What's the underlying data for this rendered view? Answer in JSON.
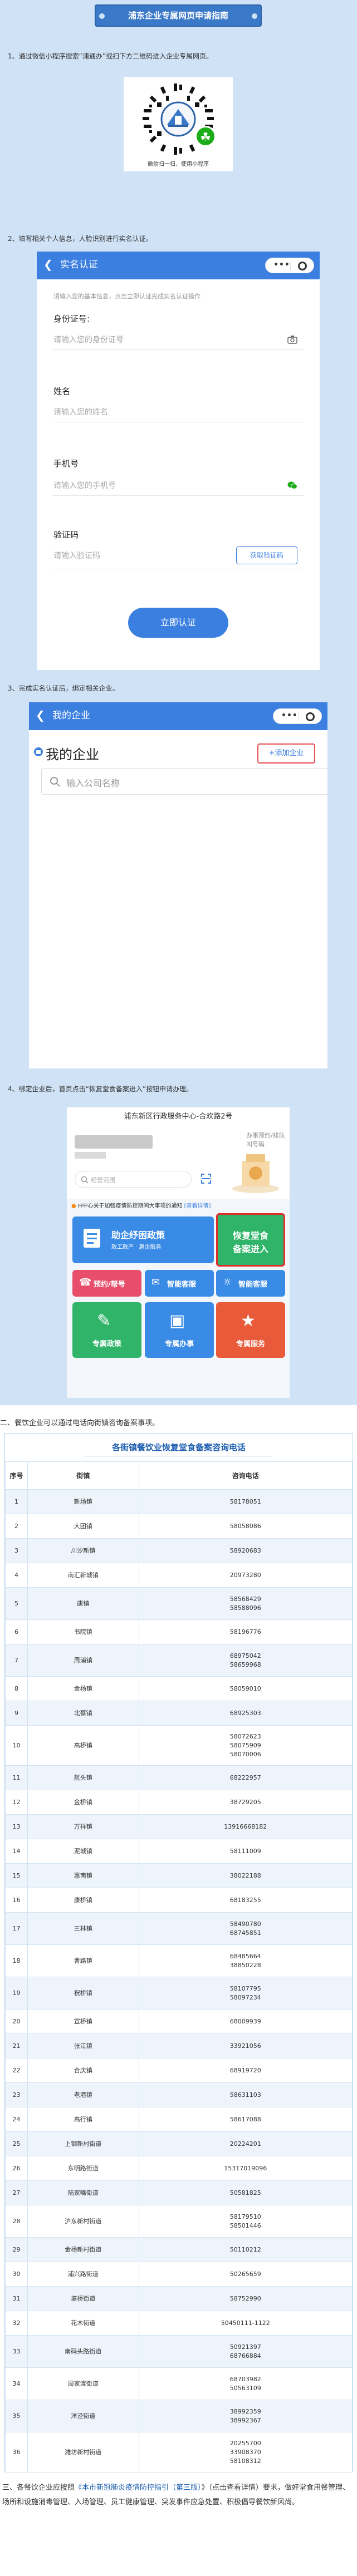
{
  "guide": {
    "banner": "浦东企业专属网页申请指南",
    "step1": "1、通过微信小程序搜索“浦通办”或扫下方二维码进入企业专属网页。",
    "qr_caption": "微信扫一扫，使用小程序",
    "step2": "2、填写相关个人信息，人脸识别进行实名认证。",
    "step3": "3、完成实名认证后，绑定相关企业。",
    "step4": "4、绑定企业后，首页点击“恢复堂食备案进入”按钮申请办理。"
  },
  "realname": {
    "nav_title": "实名认证",
    "tip": "请输入您的基本信息，点击立即认证完成实名认证操作",
    "id_label": "身份证号:",
    "id_placeholder": "请输入您的身份证号",
    "name_label": "姓名",
    "name_placeholder": "请输入您的姓名",
    "phone_label": "手机号",
    "phone_placeholder": "请输入您的手机号",
    "code_label": "验证码",
    "code_placeholder": "请输入验证码",
    "code_button": "获取验证码",
    "submit": "立即认证"
  },
  "enterprise": {
    "nav_title": "我的企业",
    "heading": "我的企业",
    "add_button": "+添加企业",
    "search_placeholder": "输入公司名称"
  },
  "home": {
    "header": "浦东新区行政服务中心-合欢路2号",
    "location": "办事预约/排队",
    "location2": "叫号码",
    "search_placeholder": "经营范围",
    "notice": "H中心关于加强疫情防控期间大事项的通知",
    "notice_more": "[查看详情]",
    "tile_policy": "助企纾困政策",
    "tile_policy_sub": "政工政产 · 惠企服务",
    "tile_restore": "恢复堂食",
    "tile_restore2": "备案进入",
    "tile_booking": "预约/帮号",
    "tile_cust": "智能客服",
    "tile_p1": "专属政策",
    "tile_p2": "专属办事",
    "tile_p3": "专属服务"
  },
  "section2_title": "二、餐饮企业可以通过电话向街镇咨询备案事项。",
  "table": {
    "title": "各街镇餐饮业恢复堂食备案咨询电话",
    "headers": [
      "序号",
      "街镇",
      "咨询电话"
    ],
    "rows": [
      [
        "1",
        "新场镇",
        "58178051"
      ],
      [
        "2",
        "大团镇",
        "58058086"
      ],
      [
        "3",
        "川沙新镇",
        "58920683"
      ],
      [
        "4",
        "南汇新城镇",
        "20973280"
      ],
      [
        "5",
        "唐镇",
        "58568429\n58588096"
      ],
      [
        "6",
        "书院镇",
        "58196776"
      ],
      [
        "7",
        "周浦镇",
        "68975042\n58659968"
      ],
      [
        "8",
        "金杨镇",
        "58059010"
      ],
      [
        "9",
        "北蔡镇",
        "68925303"
      ],
      [
        "10",
        "高桥镇",
        "58072623\n58075909\n58070006"
      ],
      [
        "11",
        "航头镇",
        "68222957"
      ],
      [
        "12",
        "金桥镇",
        "38729205"
      ],
      [
        "13",
        "万祥镇",
        "13916668182"
      ],
      [
        "14",
        "泥城镇",
        "58111009"
      ],
      [
        "15",
        "惠南镇",
        "38022188"
      ],
      [
        "16",
        "康桥镇",
        "68183255"
      ],
      [
        "17",
        "三林镇",
        "58490780\n68745851"
      ],
      [
        "18",
        "曹路镇",
        "68485664\n38850228"
      ],
      [
        "19",
        "祝桥镇",
        "58107795\n58097234"
      ],
      [
        "20",
        "宣桥镇",
        "68009939"
      ],
      [
        "21",
        "张江镇",
        "33921056"
      ],
      [
        "22",
        "合庆镇",
        "68919720"
      ],
      [
        "23",
        "老港镇",
        "58631103"
      ],
      [
        "24",
        "高行镇",
        "58617088"
      ],
      [
        "25",
        "上钢新村街道",
        "20224201"
      ],
      [
        "26",
        "东明路街道",
        "15317019096"
      ],
      [
        "27",
        "陆家嘴街道",
        "50581825"
      ],
      [
        "28",
        "沪东新村街道",
        "58179510\n58501446"
      ],
      [
        "29",
        "金杨新村街道",
        "50110212"
      ],
      [
        "30",
        "浦兴路街道",
        "50265659"
      ],
      [
        "31",
        "塘桥街道",
        "58752990"
      ],
      [
        "32",
        "花木街道",
        "50450111-1122"
      ],
      [
        "33",
        "南码头路街道",
        "50921397\n68766884"
      ],
      [
        "34",
        "周家渡街道",
        "68703982\n50563109"
      ],
      [
        "35",
        "洋泾街道",
        "38992359\n38992367"
      ],
      [
        "36",
        "潍坊新村街道",
        "20255700\n33908370\n58108312"
      ]
    ]
  },
  "footer": {
    "prefix": "三、各餐饮企业应按照",
    "link": "《本市新冠肺炎疫情防控指引（第三版）",
    "suffix": "》（点击查看详情）要求，做好堂食用餐管理、场所和设施消毒管理、入场管理、员工健康管理、突发事件应急处置、积极倡导餐饮新风尚。"
  }
}
